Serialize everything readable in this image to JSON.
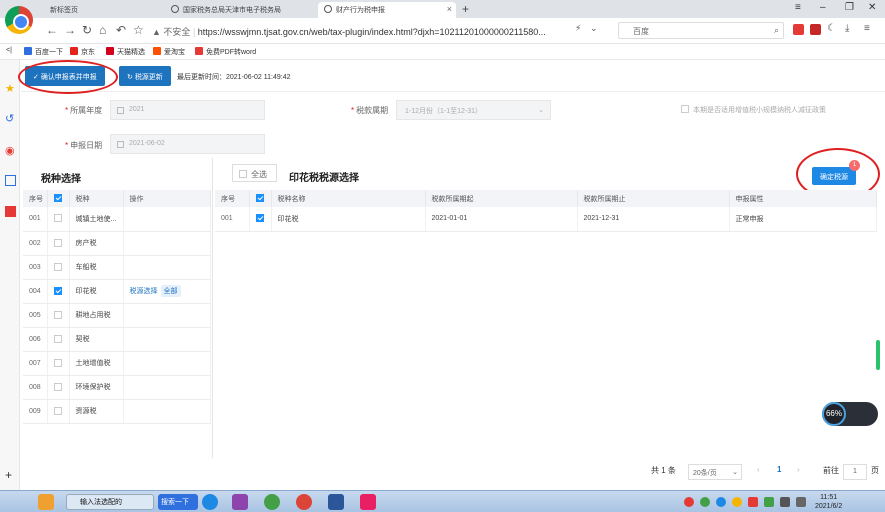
{
  "browser": {
    "tabs": [
      {
        "label": "新标签页"
      },
      {
        "label": "国家税务总局天津市电子税务局"
      },
      {
        "label": "财产行为税申报"
      }
    ],
    "address": {
      "security": "不安全",
      "url": "https://wsswjmn.tjsat.gov.cn/web/tax-plugin/index.html?djxh=10211201000000211580..."
    },
    "search_placeholder": "百度",
    "bookmarks": [
      {
        "label": "百度一下"
      },
      {
        "label": "京东"
      },
      {
        "label": "天猫精选"
      },
      {
        "label": "爱淘宝"
      },
      {
        "label": "免费PDF转word"
      }
    ]
  },
  "toolbar": {
    "confirm_declare_label": "确认申报表并申报",
    "refresh_label": "税源更新",
    "last_update": "最后更新时间：2021-06-02 11:49:42"
  },
  "form": {
    "year_label": "所属年度",
    "year_value": "2021",
    "period_label": "税款属期",
    "period_value": "1-12月份（1-1至12-31）",
    "date_label": "申报日期",
    "date_value": "2021-06-02",
    "hint": "本期是否适用增值税小规模纳税人减征政策"
  },
  "left_panel": {
    "title": "税种选择",
    "headers": [
      "序号",
      "",
      "税种",
      "操作"
    ],
    "rows": [
      {
        "no": "001",
        "name": "城镇土地使...",
        "checked": false,
        "op": "",
        "op_all": ""
      },
      {
        "no": "002",
        "name": "房产税",
        "checked": false,
        "op": "",
        "op_all": ""
      },
      {
        "no": "003",
        "name": "车船税",
        "checked": false,
        "op": "",
        "op_all": ""
      },
      {
        "no": "004",
        "name": "印花税",
        "checked": true,
        "op": "税源选择",
        "op_all": "全部"
      },
      {
        "no": "005",
        "name": "耕地占用税",
        "checked": false,
        "op": "",
        "op_all": ""
      },
      {
        "no": "006",
        "name": "契税",
        "checked": false,
        "op": "",
        "op_all": ""
      },
      {
        "no": "007",
        "name": "土地增值税",
        "checked": false,
        "op": "",
        "op_all": ""
      },
      {
        "no": "008",
        "name": "环境保护税",
        "checked": false,
        "op": "",
        "op_all": ""
      },
      {
        "no": "009",
        "name": "资源税",
        "checked": false,
        "op": "",
        "op_all": ""
      }
    ]
  },
  "right_panel": {
    "select_all": "全选",
    "title": "印花税税源选择",
    "confirm_label": "确定税源",
    "badge": "1",
    "headers": [
      "序号",
      "",
      "税种名称",
      "税款所属期起",
      "税款所属期止",
      "申报属性"
    ],
    "rows": [
      {
        "no": "001",
        "name": "印花税",
        "start": "2021-01-01",
        "end": "2021-12-31",
        "attr": "正常申报",
        "checked": true
      }
    ]
  },
  "pager": {
    "total": "共 1 条",
    "page_size": "20条/页",
    "prev": "‹",
    "current": "1",
    "next": "›",
    "goto_label": "前往",
    "goto_value": "1",
    "page_unit": "页"
  },
  "widget": {
    "speed": "66%"
  },
  "taskbar": {
    "items": [
      {
        "label": "输入法选配的"
      },
      {
        "label": "搜索一下"
      }
    ],
    "time": "11:51",
    "date": "2021/6/2"
  },
  "colors": {
    "primary": "#1e73be",
    "danger": "#e02020",
    "check": "#1890ff"
  }
}
